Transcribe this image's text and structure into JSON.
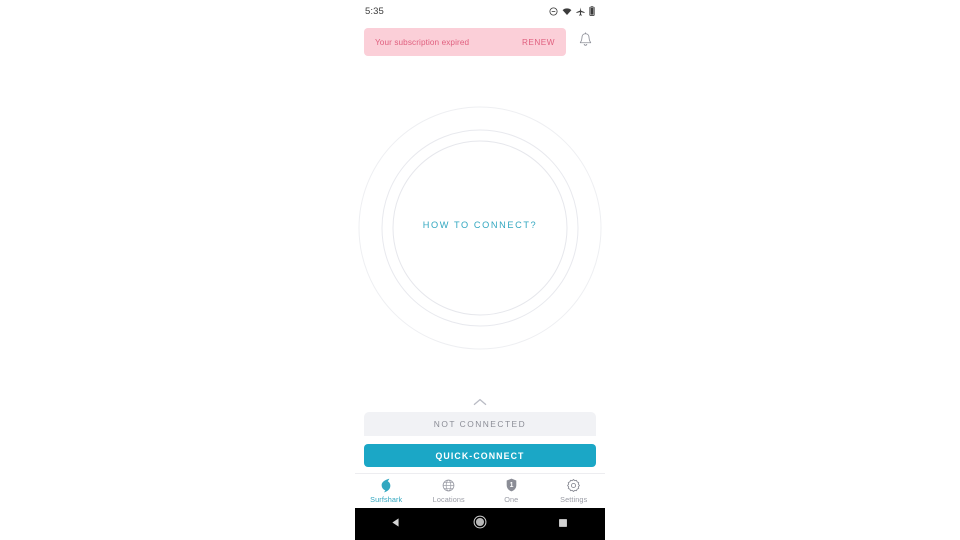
{
  "status_bar": {
    "clock": "5:35",
    "icons": [
      "do-not-disturb-icon",
      "wifi-icon",
      "airplane-mode-icon",
      "battery-icon"
    ]
  },
  "banner": {
    "message": "Your subscription expired",
    "action_label": "RENEW",
    "bell_icon": "notification-bell-icon",
    "background_color": "#fbcfd8",
    "text_color": "#e0607f"
  },
  "hero": {
    "how_to_connect_label": "HOW TO CONNECT?",
    "accent_color": "#32a7c0",
    "ring_color": "#e9eaee",
    "ring_count": 3
  },
  "sheet": {
    "handle_icon": "chevron-up-icon",
    "status_label": "NOT CONNECTED",
    "quick_connect_label": "QUICK-CONNECT",
    "quick_connect_color": "#1ba7c6",
    "status_panel_color": "#f1f2f5"
  },
  "tabs": [
    {
      "label": "Surfshark",
      "icon": "surfshark-logo-icon",
      "active": true
    },
    {
      "label": "Locations",
      "icon": "globe-grid-icon",
      "active": false
    },
    {
      "label": "One",
      "icon": "shield-one-icon",
      "active": false
    },
    {
      "label": "Settings",
      "icon": "gear-icon",
      "active": false
    }
  ],
  "nav_bar": {
    "back_label": "back-icon",
    "home_label": "home-icon",
    "recents_label": "recents-icon"
  }
}
